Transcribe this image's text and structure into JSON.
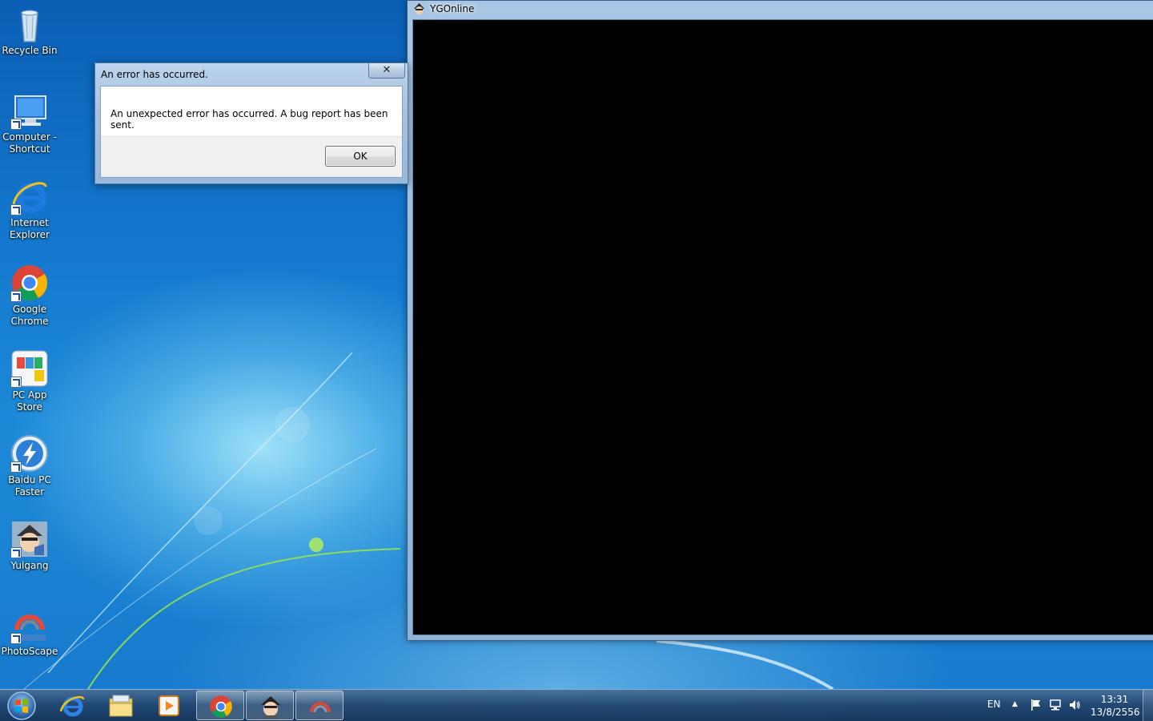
{
  "desktop": {
    "icons": [
      {
        "label": "Recycle Bin",
        "icon": "recycle-bin-icon"
      },
      {
        "label": "Computer - Shortcut",
        "icon": "computer-icon"
      },
      {
        "label": "Internet Explorer",
        "icon": "internet-explorer-icon"
      },
      {
        "label": "Google Chrome",
        "icon": "chrome-icon"
      },
      {
        "label": "PC App Store",
        "icon": "app-store-icon"
      },
      {
        "label": "Baidu PC Faster",
        "icon": "baidu-pc-faster-icon"
      },
      {
        "label": "Yulgang",
        "icon": "yulgang-icon"
      },
      {
        "label": "PhotoScape",
        "icon": "photoscape-icon"
      }
    ]
  },
  "ygo_window": {
    "title": "YGOnline"
  },
  "error_dialog": {
    "title": "An error has occurred.",
    "close_label": "✕",
    "message": "An unexpected error has occurred. A bug report has been sent.",
    "ok_label": "OK"
  },
  "taskbar": {
    "items": [
      {
        "icon": "internet-explorer-icon",
        "active": false
      },
      {
        "icon": "file-explorer-icon",
        "active": false
      },
      {
        "icon": "media-player-icon",
        "active": false
      },
      {
        "icon": "chrome-icon",
        "active": true
      },
      {
        "icon": "yulgang-icon",
        "active": true
      },
      {
        "icon": "photoscape-icon",
        "active": true
      }
    ],
    "tray": {
      "language": "EN",
      "arrow": "▲",
      "icons": [
        "action-center-flag-icon",
        "network-icon",
        "volume-icon"
      ]
    },
    "clock": {
      "time": "13:31",
      "date": "13/8/2556"
    }
  },
  "colors": {
    "desktop_blue": "#1479cf",
    "window_frame": "#a9c6e4",
    "game_client": "#000000"
  }
}
